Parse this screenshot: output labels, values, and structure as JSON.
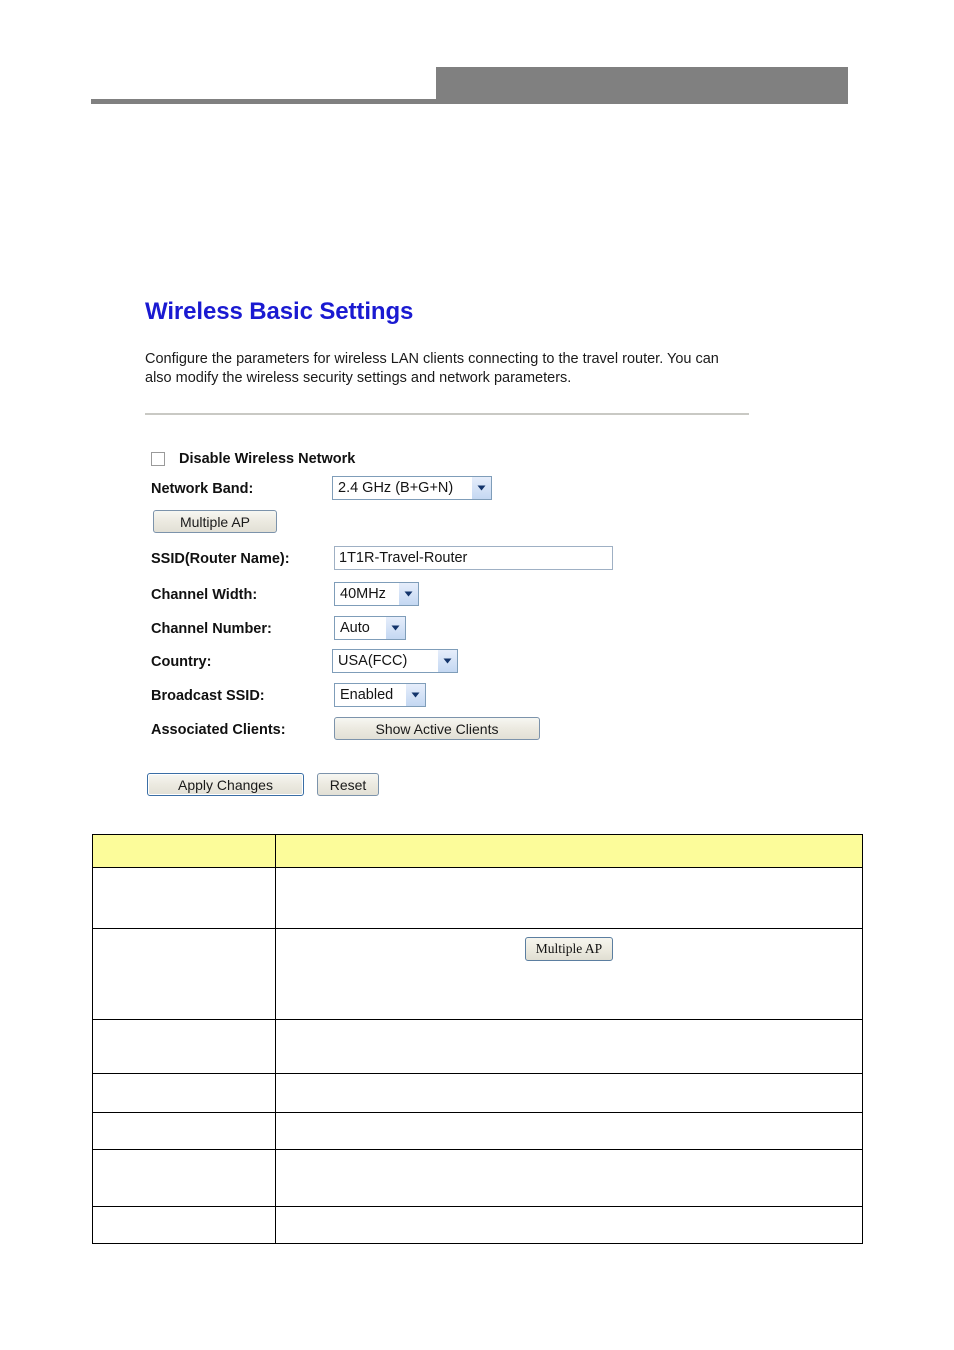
{
  "panel": {
    "title": "Wireless Basic Settings",
    "description": "Configure the parameters for wireless LAN clients connecting to the travel router. You can also modify the wireless security settings and network parameters.",
    "fields": {
      "disable_wireless_label": "Disable Wireless Network",
      "disable_wireless_checked": false,
      "network_band_label": "Network Band:",
      "network_band_value": "2.4 GHz (B+G+N)",
      "multiple_ap_label": "Multiple AP",
      "ssid_label": "SSID(Router Name):",
      "ssid_value": "1T1R-Travel-Router",
      "channel_width_label": "Channel Width:",
      "channel_width_value": "40MHz",
      "channel_number_label": "Channel Number:",
      "channel_number_value": "Auto",
      "country_label": "Country:",
      "country_value": "USA(FCC)",
      "broadcast_ssid_label": "Broadcast SSID:",
      "broadcast_ssid_value": "Enabled",
      "associated_clients_label": "Associated Clients:",
      "show_active_clients_label": "Show Active Clients"
    },
    "actions": {
      "apply_label": "Apply Changes",
      "reset_label": "Reset"
    },
    "colors": {
      "title_blue": "#1a1ad1",
      "select_border": "#7f9db9",
      "table_header_yellow": "#fcfc9a",
      "header_band_gray": "#808080"
    }
  },
  "spec_table": {
    "header": {
      "term": "",
      "description": ""
    },
    "rows": [
      {
        "term": "",
        "description": "",
        "button": ""
      },
      {
        "term": "",
        "description": "",
        "button": "Multiple AP"
      },
      {
        "term": "",
        "description": "",
        "button": ""
      },
      {
        "term": "",
        "description": "",
        "button": ""
      },
      {
        "term": "",
        "description": "",
        "button": ""
      },
      {
        "term": "",
        "description": "",
        "button": ""
      },
      {
        "term": "",
        "description": "",
        "button": ""
      }
    ]
  }
}
